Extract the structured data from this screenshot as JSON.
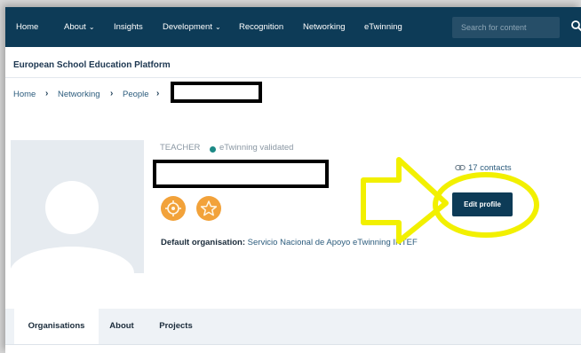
{
  "nav": {
    "items": [
      {
        "label": "Home",
        "dropdown": false
      },
      {
        "label": "About",
        "dropdown": true
      },
      {
        "label": "Insights",
        "dropdown": false
      },
      {
        "label": "Development",
        "dropdown": true
      },
      {
        "label": "Recognition",
        "dropdown": false
      },
      {
        "label": "Networking",
        "dropdown": false
      },
      {
        "label": "eTwinning",
        "dropdown": false
      }
    ],
    "search_placeholder": "Search for content",
    "caret": "⌄"
  },
  "platform_title": "European School Education Platform",
  "breadcrumb": [
    "Home",
    "Networking",
    "People"
  ],
  "breadcrumb_sep": "›",
  "profile": {
    "role": "TEACHER",
    "validation": "eTwinning validated",
    "default_org_label": "Default organisation:",
    "default_org_name": "Servicio Nacional de Apoyo eTwinning INTEF",
    "contacts": "17 contacts",
    "edit_button": "Edit profile",
    "badge_icons": [
      "gear-badge-icon",
      "star-badge-icon"
    ]
  },
  "tabs": [
    "Organisations",
    "About",
    "Projects"
  ],
  "colors": {
    "nav_bg": "#0d3b57",
    "accent_teal": "#1c8a86",
    "badge_orange": "#f2a23a",
    "annotation_yellow": "#f2f000"
  }
}
